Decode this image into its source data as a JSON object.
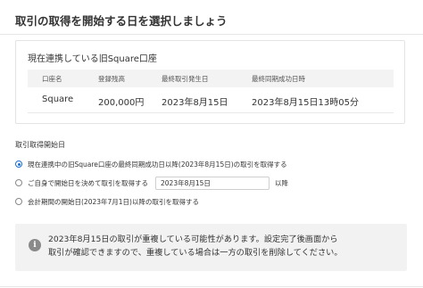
{
  "page_title": "取引の取得を開始する日を選択しましょう",
  "account_card": {
    "title": "現在連携している旧Square口座",
    "columns": [
      "口座名",
      "登録残高",
      "最終取引発生日",
      "最終同期成功日時"
    ],
    "row": [
      "Square",
      "200,000円",
      "2023年8月15日",
      "2023年8月15日13時05分"
    ]
  },
  "start_date_section": {
    "label": "取引取得開始日",
    "options": [
      {
        "text": "現在連携中の旧Square口座の最終同期成功日以降(2023年8月15日)の取引を取得する",
        "selected": true
      },
      {
        "text": "ご自身で開始日を決めて取引を取得する",
        "selected": false,
        "input_value": "2023年8月15日",
        "suffix": "以降"
      },
      {
        "text": "会計期間の開始日(2023年7月1日)以降の取引を取得する",
        "selected": false
      }
    ]
  },
  "notice": {
    "icon": "info-icon",
    "line1": "2023年8月15日の取引が重複している可能性があります。設定完了後画面から",
    "line2": "取引が確認できますので、重複している場合は一方の取引を削除してください。"
  },
  "colors": {
    "accent": "#1a6fd6",
    "notice_bg": "#f2f2f2",
    "table_header_bg": "#f3f3f3"
  }
}
